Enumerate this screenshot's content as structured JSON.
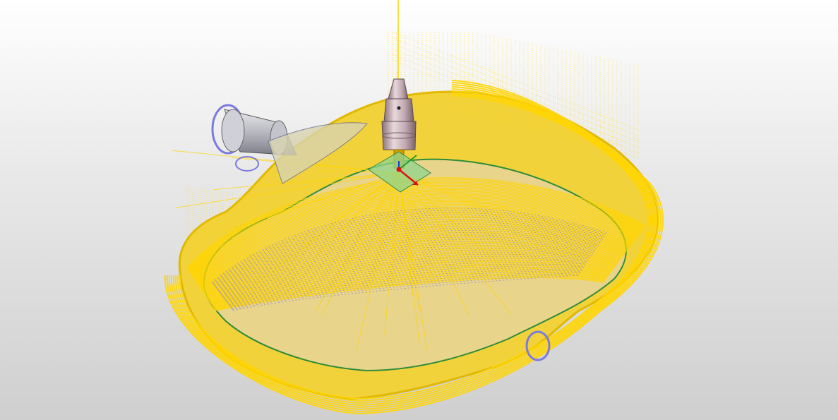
{
  "viewport": {
    "background_top": "#ffffff",
    "background_bottom": "#cfcfcf"
  },
  "scene": {
    "toolpath_color": "#ffd500",
    "toolpath_dark": "#e0b800",
    "surface_wire_color": "#8080e0",
    "edge_color": "#2e8b3a",
    "tool_holder_color": "#c0a8b0",
    "tool_holder_shade": "#8a7078",
    "tool_tip_color": "#d4a000",
    "fixture_color": "#b8b8c0",
    "workplane_color": "#8fd48f",
    "axis_x_color": "#e01010",
    "axis_y_color": "#20a020",
    "axis_z_color": "#1040e0"
  },
  "icons": {
    "tool": "tool-holder-icon",
    "workplane": "workplane-icon",
    "axes": "axis-triad-icon",
    "fixture": "rotary-fixture-icon"
  }
}
